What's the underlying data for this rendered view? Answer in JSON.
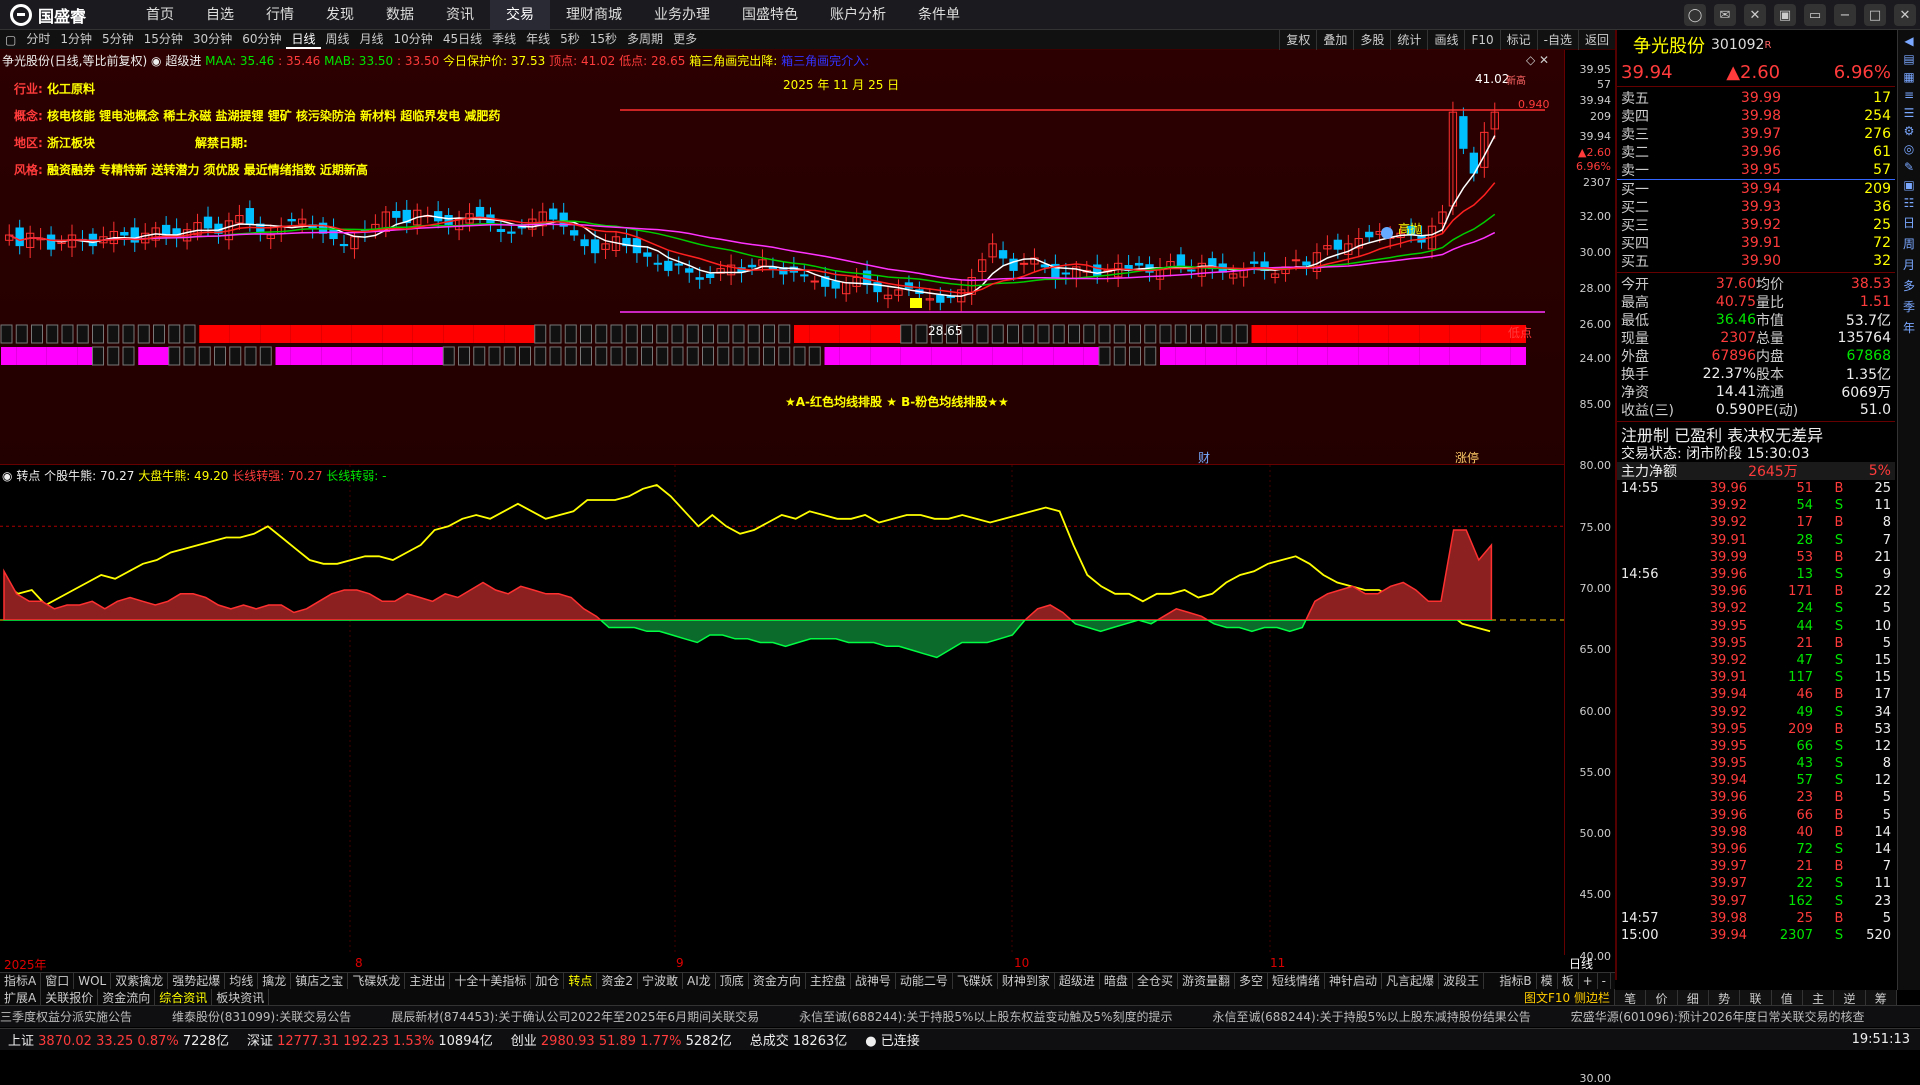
{
  "nav": {
    "logo": "国盛睿",
    "items": [
      "首页",
      "自选",
      "行情",
      "发现",
      "数据",
      "资讯",
      "交易",
      "理财商城",
      "业务办理",
      "国盛特色",
      "账户分析",
      "条件单"
    ],
    "active": "交易"
  },
  "periods": {
    "items": [
      "分时",
      "1分钟",
      "5分钟",
      "15分钟",
      "30分钟",
      "60分钟",
      "日线",
      "周线",
      "月线",
      "10分钟",
      "45日线",
      "季线",
      "年线",
      "5秒",
      "15秒",
      "多周期",
      "更多"
    ],
    "active": "日线"
  },
  "toolbtns": [
    "复权",
    "叠加",
    "多股",
    "统计",
    "画线",
    "F10",
    "标记",
    "-自选",
    "返回"
  ],
  "chart": {
    "header": "争光股份(日线,等比前复权)",
    "super": "超级进",
    "maa": "MAA: 35.46",
    "maa2": ": 35.46",
    "mab": "MAB: 33.50",
    "mab2": ": 33.50",
    "protect": "今日保护价: 37.53",
    "top": "顶点: 41.02",
    "bottom": "低点: 28.65",
    "tri1": "箱三角画完出降:",
    "tri2": "箱三角画完介入:",
    "date": "2025 年 11 月 25 日",
    "industry_label": "行业:",
    "industry": "化工原料",
    "concept_label": "概念:",
    "concept": "核电核能 锂电池概念 稀土永磁 盐湖提锂 锂矿 核污染防治 新材料 超临界发电 减肥药",
    "region_label": "地区:",
    "region": "浙江板块",
    "unban_label": "解禁日期:",
    "style_label": "风格:",
    "style": "融资融券 专精特新 送转潜力 须优股 最近情绪指数 近期新高",
    "high_val": "41.02",
    "low_val": "28.65",
    "close_tag": "0.940",
    "high_tag": "高抛",
    "low_tag": "低点",
    "top_tag": "新高",
    "band": "★A-红色均线排股 ★ B-粉色均线排股★★",
    "cai": "财",
    "zhangting": "涨停"
  },
  "ind": {
    "title": "转点",
    "a": "个股牛熊: 70.27",
    "b": "大盘牛熊: 49.20",
    "c": "长线转强: 70.27",
    "d": "长线转弱: -"
  },
  "xaxis": {
    "labels": [
      "2025年",
      "8",
      "9",
      "10",
      "11"
    ],
    "period": "日线"
  },
  "price_axis": [
    "39.95",
    "57",
    "39.94",
    "209",
    "39.94",
    "▲2.60",
    "6.96%",
    "2307",
    "32.00",
    "30.00",
    "28.00",
    "26.00",
    "24.00"
  ],
  "ind_axis": [
    "85.00",
    "80.00",
    "75.00",
    "70.00",
    "65.00",
    "60.00",
    "55.00",
    "50.00",
    "45.00",
    "40.00",
    "35.00",
    "30.00"
  ],
  "quote": {
    "name": "争光股份",
    "code": "301092",
    "mark": "R",
    "price": "39.94",
    "chg": "▲2.60",
    "pct": "6.96%",
    "asks": [
      [
        "卖五",
        "39.99",
        "17"
      ],
      [
        "卖四",
        "39.98",
        "254"
      ],
      [
        "卖三",
        "39.97",
        "276"
      ],
      [
        "卖二",
        "39.96",
        "61"
      ],
      [
        "卖一",
        "39.95",
        "57"
      ]
    ],
    "bids": [
      [
        "买一",
        "39.94",
        "209"
      ],
      [
        "买二",
        "39.93",
        "36"
      ],
      [
        "买三",
        "39.92",
        "25"
      ],
      [
        "买四",
        "39.91",
        "72"
      ],
      [
        "买五",
        "39.90",
        "32"
      ]
    ],
    "stats": [
      [
        "今开",
        "37.60",
        "均价",
        "38.53"
      ],
      [
        "最高",
        "40.75",
        "量比",
        "1.51"
      ],
      [
        "最低",
        "36.46",
        "市值",
        "53.7亿"
      ],
      [
        "现量",
        "2307",
        "总量",
        "135764"
      ],
      [
        "外盘",
        "67896",
        "内盘",
        "67868"
      ],
      [
        "换手",
        "22.37%",
        "股本",
        "1.35亿"
      ],
      [
        "净资",
        "14.41",
        "流通",
        "6069万"
      ],
      [
        "收益(三)",
        "0.590",
        "PE(动)",
        "51.0"
      ]
    ],
    "reg": "注册制 已盈利 表决权无差异",
    "trade_state": "交易状态: 闭市阶段 15:30:03",
    "flow_label": "主力净额",
    "flow_val": "2645万",
    "flow_pct": "5%",
    "ticks": [
      [
        "14:55",
        "39.96",
        "51",
        "B",
        "25"
      ],
      [
        "",
        "39.92",
        "54",
        "S",
        "11"
      ],
      [
        "",
        "39.92",
        "17",
        "B",
        "8"
      ],
      [
        "",
        "39.91",
        "28",
        "S",
        "7"
      ],
      [
        "",
        "39.99",
        "53",
        "B",
        "21"
      ],
      [
        "14:56",
        "39.96",
        "13",
        "S",
        "9"
      ],
      [
        "",
        "39.96",
        "171",
        "B",
        "22"
      ],
      [
        "",
        "39.92",
        "24",
        "S",
        "5"
      ],
      [
        "",
        "39.95",
        "44",
        "S",
        "10"
      ],
      [
        "",
        "39.95",
        "21",
        "B",
        "5"
      ],
      [
        "",
        "39.92",
        "47",
        "S",
        "15"
      ],
      [
        "",
        "39.91",
        "117",
        "S",
        "15"
      ],
      [
        "",
        "39.94",
        "46",
        "B",
        "17"
      ],
      [
        "",
        "39.92",
        "49",
        "S",
        "34"
      ],
      [
        "",
        "39.95",
        "209",
        "B",
        "53"
      ],
      [
        "",
        "39.95",
        "66",
        "S",
        "12"
      ],
      [
        "",
        "39.95",
        "43",
        "S",
        "8"
      ],
      [
        "",
        "39.94",
        "57",
        "S",
        "12"
      ],
      [
        "",
        "39.96",
        "23",
        "B",
        "5"
      ],
      [
        "",
        "39.96",
        "66",
        "B",
        "5"
      ],
      [
        "",
        "39.98",
        "40",
        "B",
        "14"
      ],
      [
        "",
        "39.96",
        "72",
        "S",
        "14"
      ],
      [
        "",
        "39.97",
        "21",
        "B",
        "7"
      ],
      [
        "",
        "39.97",
        "22",
        "S",
        "11"
      ],
      [
        "",
        "39.97",
        "162",
        "S",
        "23"
      ],
      [
        "14:57",
        "39.98",
        "25",
        "B",
        "5"
      ],
      [
        "15:00",
        "39.94",
        "2307",
        "S",
        "520"
      ]
    ]
  },
  "rbottom": [
    "笔",
    "价",
    "细",
    "势",
    "联",
    "值",
    "主",
    "逆",
    "筹"
  ],
  "sidebar": [
    "日",
    "周",
    "月",
    "多",
    "季",
    "年"
  ],
  "tabs": [
    "指标A",
    "窗口",
    "WOL",
    "双紫擒龙",
    "强势起爆",
    "均线",
    "擒龙",
    "镇店之宝",
    "飞碟妖龙",
    "主进出",
    "十全十美指标",
    "加仓",
    "转点",
    "资金2",
    "宁波敢",
    "AI龙",
    "顶底",
    "资金方向",
    "主控盘",
    "战神号",
    "动能二号",
    "飞碟妖",
    "财神到家",
    "超级进",
    "暗盘",
    "全仓买",
    "游资量翻",
    "多空",
    "短线情绪",
    "神针启动",
    "凡言起爆",
    "波段王"
  ],
  "tabs_active": "转点",
  "tabs_right": [
    "指标B",
    "模",
    "板",
    "+",
    "-"
  ],
  "subtabs": [
    "扩展A",
    "关联报价",
    "资金流向",
    "综合资讯",
    "板块资讯"
  ],
  "subtabs_active": "综合资讯",
  "f10": "图文F10 侧边栏",
  "news": [
    "三季度权益分派实施公告",
    "维泰股份(831099):关联交易公告",
    "展辰新材(874453):关于确认公司2022年至2025年6月期间关联交易",
    "永信至诚(688244):关于持股5%以上股东权益变动触及5%刻度的提示",
    "永信至诚(688244):关于持股5%以上股东减持股份结果公告",
    "宏盛华源(601096):预计2026年度日常关联交易的核查"
  ],
  "status": {
    "sh": "上证",
    "sh_v": "3870.02",
    "sh_c": "33.25",
    "sh_p": "0.87%",
    "sh_a": "7228亿",
    "sz": "深证",
    "sz_v": "12777.31",
    "sz_c": "192.23",
    "sz_p": "1.53%",
    "sz_a": "10894亿",
    "cy": "创业",
    "cy_v": "2980.93",
    "cy_c": "51.89",
    "cy_p": "1.77%",
    "cy_a": "5282亿",
    "total": "总成交",
    "total_v": "18263亿",
    "conn": "已连接",
    "time": "19:51:13"
  },
  "colors": {
    "up": "#ff3b3b",
    "down": "#00c8ff",
    "ma1": "#ffffff",
    "ma2": "#00cc00",
    "ma3": "#ff33ff",
    "ind": "#ffff00"
  }
}
